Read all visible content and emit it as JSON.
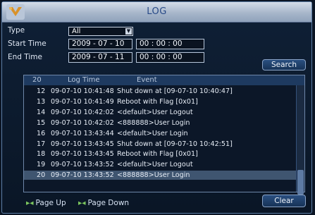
{
  "window": {
    "title": "LOG"
  },
  "filters": {
    "type_label": "Type",
    "type_value": "All",
    "start_label": "Start Time",
    "start_date": "2009 - 07 - 10",
    "start_time": "00 : 00 : 00",
    "end_label": "End Time",
    "end_date": "2009 - 07 - 11",
    "end_time": "00 : 00 : 00",
    "search_label": "Search"
  },
  "table": {
    "count": "20",
    "col_time": "Log Time",
    "col_event": "Event",
    "rows": [
      {
        "num": "12",
        "time": "09-07-10 10:41:48",
        "event": "Shut down at [09-07-10 10:40:47]"
      },
      {
        "num": "13",
        "time": "09-07-10 10:41:49",
        "event": "Reboot with Flag [0x01]"
      },
      {
        "num": "14",
        "time": "09-07-10 10:42:02",
        "event": "<default>User Logout"
      },
      {
        "num": "15",
        "time": "09-07-10 10:42:02",
        "event": "<888888>User Login"
      },
      {
        "num": "16",
        "time": "09-07-10 13:43:44",
        "event": "<default>User Login"
      },
      {
        "num": "17",
        "time": "09-07-10 13:43:45",
        "event": "Shut down at [09-07-10 10:42:51]"
      },
      {
        "num": "18",
        "time": "09-07-10 13:43:45",
        "event": "Reboot with Flag [0x01]"
      },
      {
        "num": "19",
        "time": "09-07-10 13:43:52",
        "event": "<default>User Logout"
      },
      {
        "num": "20",
        "time": "09-07-10 13:43:52",
        "event": "<888888>User Login"
      }
    ],
    "selected_row": "20"
  },
  "footer": {
    "page_up": "Page Up",
    "page_down": "Page Down",
    "clear_label": "Clear"
  },
  "colors": {
    "accent": "#5d7ea6",
    "title_text": "#284a87",
    "selected_row": "#3f5570",
    "pager_icon": "#7ec85f"
  }
}
